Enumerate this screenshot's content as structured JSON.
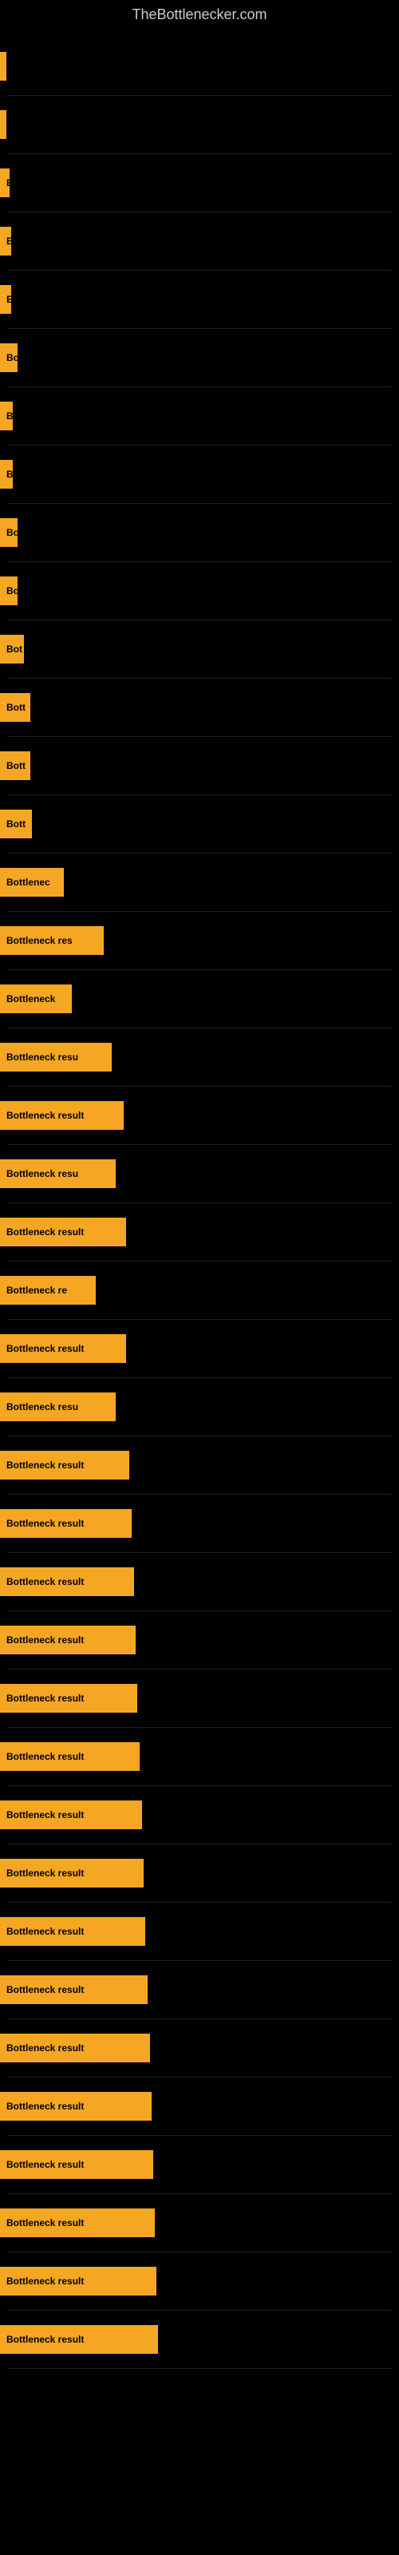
{
  "site": {
    "title": "TheBottlenecker.com"
  },
  "bars": [
    {
      "id": 1,
      "label": "",
      "width": 8,
      "text": ""
    },
    {
      "id": 2,
      "label": "",
      "width": 8,
      "text": ""
    },
    {
      "id": 3,
      "label": "E",
      "width": 12,
      "text": "E"
    },
    {
      "id": 4,
      "label": "B",
      "width": 14,
      "text": "B"
    },
    {
      "id": 5,
      "label": "E",
      "width": 14,
      "text": "E"
    },
    {
      "id": 6,
      "label": "Bo",
      "width": 22,
      "text": "Bo"
    },
    {
      "id": 7,
      "label": "B",
      "width": 16,
      "text": "B"
    },
    {
      "id": 8,
      "label": "B",
      "width": 16,
      "text": "B"
    },
    {
      "id": 9,
      "label": "Bo",
      "width": 22,
      "text": "Bo"
    },
    {
      "id": 10,
      "label": "Bo",
      "width": 22,
      "text": "Bo"
    },
    {
      "id": 11,
      "label": "Bot",
      "width": 30,
      "text": "Bot"
    },
    {
      "id": 12,
      "label": "Bott",
      "width": 38,
      "text": "Bott"
    },
    {
      "id": 13,
      "label": "Bott",
      "width": 38,
      "text": "Bott"
    },
    {
      "id": 14,
      "label": "Bott",
      "width": 40,
      "text": "Bott"
    },
    {
      "id": 15,
      "label": "Bottlenec",
      "width": 80,
      "text": "Bottlenec"
    },
    {
      "id": 16,
      "label": "Bottleneck res",
      "width": 130,
      "text": "Bottleneck res"
    },
    {
      "id": 17,
      "label": "Bottleneck",
      "width": 90,
      "text": "Bottleneck"
    },
    {
      "id": 18,
      "label": "Bottleneck resu",
      "width": 140,
      "text": "Bottleneck resu"
    },
    {
      "id": 19,
      "label": "Bottleneck result",
      "width": 155,
      "text": "Bottleneck result"
    },
    {
      "id": 20,
      "label": "Bottleneck resu",
      "width": 145,
      "text": "Bottleneck resu"
    },
    {
      "id": 21,
      "label": "Bottleneck result",
      "width": 158,
      "text": "Bottleneck result"
    },
    {
      "id": 22,
      "label": "Bottleneck re",
      "width": 120,
      "text": "Bottleneck re"
    },
    {
      "id": 23,
      "label": "Bottleneck result",
      "width": 158,
      "text": "Bottleneck result"
    },
    {
      "id": 24,
      "label": "Bottleneck resu",
      "width": 145,
      "text": "Bottleneck resu"
    },
    {
      "id": 25,
      "label": "Bottleneck result",
      "width": 162,
      "text": "Bottleneck result"
    },
    {
      "id": 26,
      "label": "Bottleneck result",
      "width": 165,
      "text": "Bottleneck result"
    },
    {
      "id": 27,
      "label": "Bottleneck result",
      "width": 168,
      "text": "Bottleneck result"
    },
    {
      "id": 28,
      "label": "Bottleneck result",
      "width": 170,
      "text": "Bottleneck result"
    },
    {
      "id": 29,
      "label": "Bottleneck result",
      "width": 172,
      "text": "Bottleneck result"
    },
    {
      "id": 30,
      "label": "Bottleneck result",
      "width": 175,
      "text": "Bottleneck result"
    },
    {
      "id": 31,
      "label": "Bottleneck result",
      "width": 178,
      "text": "Bottleneck result"
    },
    {
      "id": 32,
      "label": "Bottleneck result",
      "width": 180,
      "text": "Bottleneck result"
    },
    {
      "id": 33,
      "label": "Bottleneck result",
      "width": 182,
      "text": "Bottleneck result"
    },
    {
      "id": 34,
      "label": "Bottleneck result",
      "width": 185,
      "text": "Bottleneck result"
    },
    {
      "id": 35,
      "label": "Bottleneck result",
      "width": 188,
      "text": "Bottleneck result"
    },
    {
      "id": 36,
      "label": "Bottleneck result",
      "width": 190,
      "text": "Bottleneck result"
    },
    {
      "id": 37,
      "label": "Bottleneck result",
      "width": 192,
      "text": "Bottleneck result"
    },
    {
      "id": 38,
      "label": "Bottleneck result",
      "width": 194,
      "text": "Bottleneck result"
    },
    {
      "id": 39,
      "label": "Bottleneck result",
      "width": 196,
      "text": "Bottleneck result"
    },
    {
      "id": 40,
      "label": "Bottleneck result",
      "width": 198,
      "text": "Bottleneck result"
    }
  ],
  "colors": {
    "bar": "#f5a623",
    "background": "#000000",
    "text": "#cccccc"
  }
}
